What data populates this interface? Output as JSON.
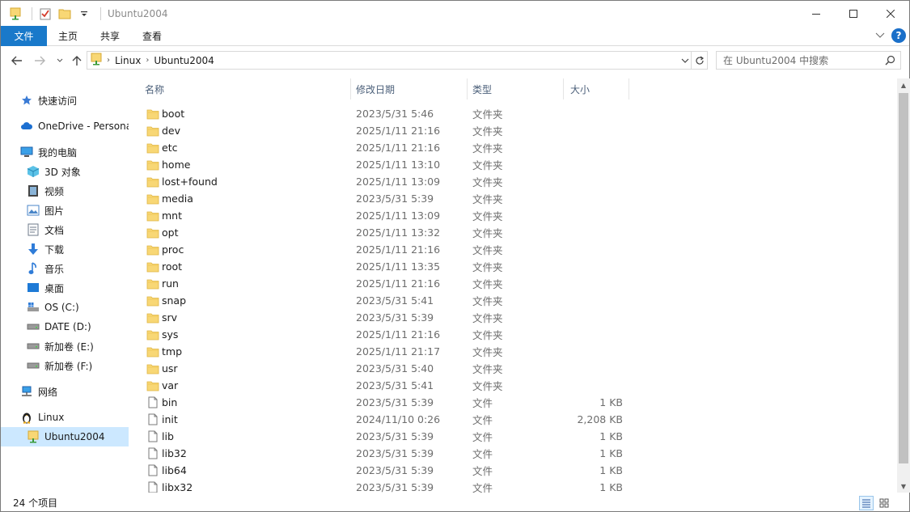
{
  "window": {
    "title": "Ubuntu2004",
    "controls": [
      "minimize-icon",
      "maximize-icon",
      "close-icon"
    ]
  },
  "quick_access_toolbar": [
    "folder-pin-icon",
    "properties-check-icon",
    "new-folder-icon",
    "customize-dropdown-icon"
  ],
  "ribbon": {
    "tabs": [
      {
        "label": "文件"
      },
      {
        "label": "主页"
      },
      {
        "label": "共享"
      },
      {
        "label": "查看"
      }
    ],
    "accent_color": "#1979ca"
  },
  "address_bar": {
    "crumbs": [
      "Linux",
      "Ubuntu2004"
    ]
  },
  "search": {
    "placeholder": "在 Ubuntu2004 中搜索"
  },
  "sidebar": {
    "items": [
      {
        "label": "快速访问",
        "icon": "star-icon",
        "level": 0
      },
      {
        "label": "OneDrive - Personal",
        "icon": "cloud-icon",
        "level": 0
      },
      {
        "label": "我的电脑",
        "icon": "computer-icon",
        "level": 0
      },
      {
        "label": "3D 对象",
        "icon": "cube-3d-icon",
        "level": 1
      },
      {
        "label": "视频",
        "icon": "video-icon",
        "level": 1
      },
      {
        "label": "图片",
        "icon": "pictures-icon",
        "level": 1
      },
      {
        "label": "文档",
        "icon": "documents-icon",
        "level": 1
      },
      {
        "label": "下载",
        "icon": "download-icon",
        "level": 1
      },
      {
        "label": "音乐",
        "icon": "music-icon",
        "level": 1
      },
      {
        "label": "桌面",
        "icon": "desktop-icon",
        "level": 1
      },
      {
        "label": "OS (C:)",
        "icon": "drive-os-icon",
        "level": 1
      },
      {
        "label": "DATE (D:)",
        "icon": "drive-icon",
        "level": 1
      },
      {
        "label": "新加卷 (E:)",
        "icon": "drive-icon",
        "level": 1
      },
      {
        "label": "新加卷 (F:)",
        "icon": "drive-icon",
        "level": 1
      },
      {
        "label": "网络",
        "icon": "network-icon",
        "level": 0
      },
      {
        "label": "Linux",
        "icon": "penguin-icon",
        "level": 0
      },
      {
        "label": "Ubuntu2004",
        "icon": "linux-distro-icon",
        "level": 1,
        "selected": true
      }
    ]
  },
  "columns": [
    {
      "label": "名称"
    },
    {
      "label": "修改日期"
    },
    {
      "label": "类型"
    },
    {
      "label": "大小"
    }
  ],
  "files": [
    {
      "name": "boot",
      "date": "2023/5/31 5:46",
      "type": "文件夹",
      "size": "",
      "kind": "folder"
    },
    {
      "name": "dev",
      "date": "2025/1/11 21:16",
      "type": "文件夹",
      "size": "",
      "kind": "folder"
    },
    {
      "name": "etc",
      "date": "2025/1/11 21:16",
      "type": "文件夹",
      "size": "",
      "kind": "folder"
    },
    {
      "name": "home",
      "date": "2025/1/11 13:10",
      "type": "文件夹",
      "size": "",
      "kind": "folder"
    },
    {
      "name": "lost+found",
      "date": "2025/1/11 13:09",
      "type": "文件夹",
      "size": "",
      "kind": "folder"
    },
    {
      "name": "media",
      "date": "2023/5/31 5:39",
      "type": "文件夹",
      "size": "",
      "kind": "folder"
    },
    {
      "name": "mnt",
      "date": "2025/1/11 13:09",
      "type": "文件夹",
      "size": "",
      "kind": "folder"
    },
    {
      "name": "opt",
      "date": "2025/1/11 13:32",
      "type": "文件夹",
      "size": "",
      "kind": "folder"
    },
    {
      "name": "proc",
      "date": "2025/1/11 21:16",
      "type": "文件夹",
      "size": "",
      "kind": "folder"
    },
    {
      "name": "root",
      "date": "2025/1/11 13:35",
      "type": "文件夹",
      "size": "",
      "kind": "folder"
    },
    {
      "name": "run",
      "date": "2025/1/11 21:16",
      "type": "文件夹",
      "size": "",
      "kind": "folder"
    },
    {
      "name": "snap",
      "date": "2023/5/31 5:41",
      "type": "文件夹",
      "size": "",
      "kind": "folder"
    },
    {
      "name": "srv",
      "date": "2023/5/31 5:39",
      "type": "文件夹",
      "size": "",
      "kind": "folder"
    },
    {
      "name": "sys",
      "date": "2025/1/11 21:16",
      "type": "文件夹",
      "size": "",
      "kind": "folder"
    },
    {
      "name": "tmp",
      "date": "2025/1/11 21:17",
      "type": "文件夹",
      "size": "",
      "kind": "folder"
    },
    {
      "name": "usr",
      "date": "2023/5/31 5:40",
      "type": "文件夹",
      "size": "",
      "kind": "folder"
    },
    {
      "name": "var",
      "date": "2023/5/31 5:41",
      "type": "文件夹",
      "size": "",
      "kind": "folder"
    },
    {
      "name": "bin",
      "date": "2023/5/31 5:39",
      "type": "文件",
      "size": "1 KB",
      "kind": "file"
    },
    {
      "name": "init",
      "date": "2024/11/10 0:26",
      "type": "文件",
      "size": "2,208 KB",
      "kind": "file"
    },
    {
      "name": "lib",
      "date": "2023/5/31 5:39",
      "type": "文件",
      "size": "1 KB",
      "kind": "file"
    },
    {
      "name": "lib32",
      "date": "2023/5/31 5:39",
      "type": "文件",
      "size": "1 KB",
      "kind": "file"
    },
    {
      "name": "lib64",
      "date": "2023/5/31 5:39",
      "type": "文件",
      "size": "1 KB",
      "kind": "file"
    },
    {
      "name": "libx32",
      "date": "2023/5/31 5:39",
      "type": "文件",
      "size": "1 KB",
      "kind": "file"
    }
  ],
  "status": {
    "item_count": "24 个项目"
  },
  "view_buttons": [
    "details-view-icon",
    "large-icons-view-icon"
  ],
  "colors": {
    "selection": "#cce8ff",
    "folder": "#f8d775",
    "header_text": "#4c607a",
    "meta_text": "#6d6d6d"
  }
}
